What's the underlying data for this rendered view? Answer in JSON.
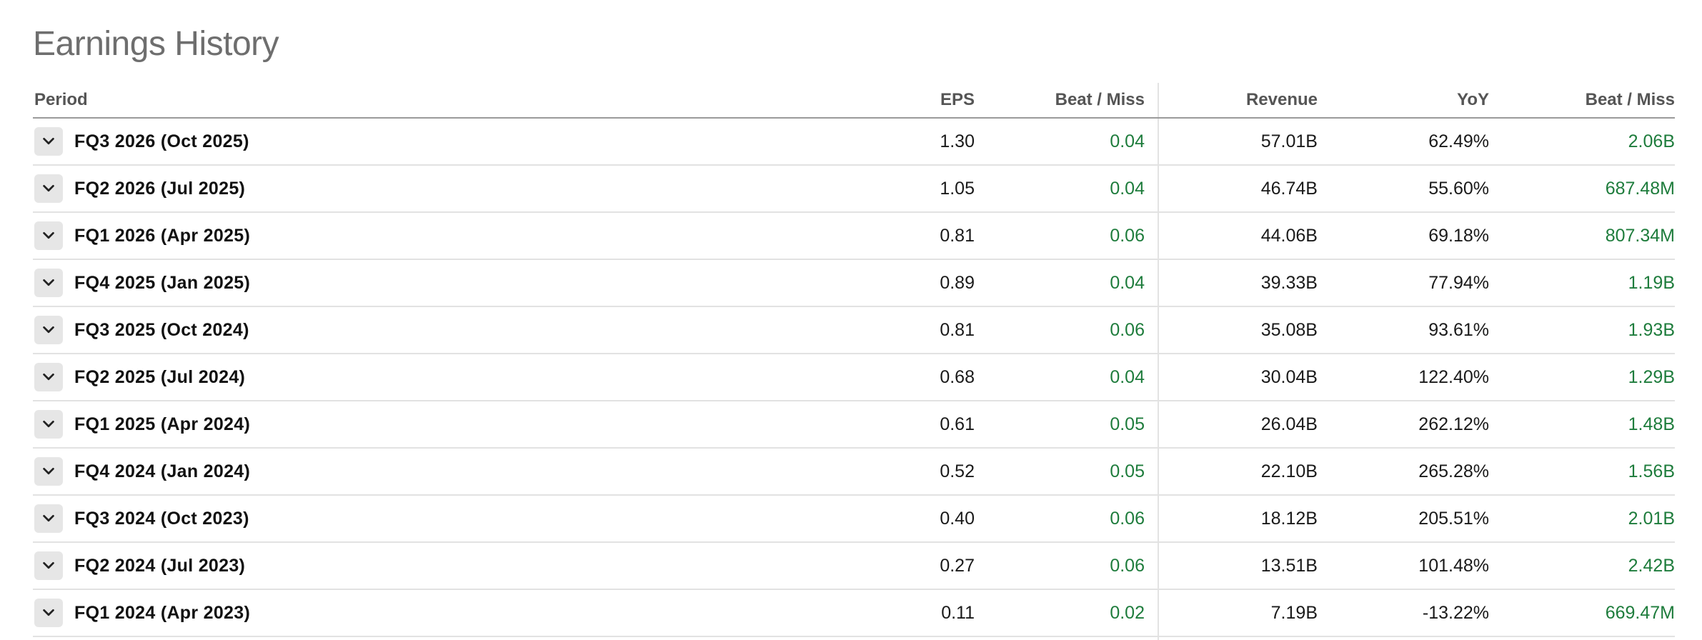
{
  "title": "Earnings History",
  "columns": {
    "period": "Period",
    "eps": "EPS",
    "eps_beat_miss": "Beat / Miss",
    "revenue": "Revenue",
    "yoy": "YoY",
    "revenue_beat_miss": "Beat / Miss"
  },
  "icons": {
    "expander": "chevron-down-icon"
  },
  "colors": {
    "positive": "#1e7c3c"
  },
  "rows": [
    {
      "period": "FQ3 2026 (Oct 2025)",
      "eps": "1.30",
      "eps_beat_miss": "0.04",
      "revenue": "57.01B",
      "yoy": "62.49%",
      "revenue_beat_miss": "2.06B"
    },
    {
      "period": "FQ2 2026 (Jul 2025)",
      "eps": "1.05",
      "eps_beat_miss": "0.04",
      "revenue": "46.74B",
      "yoy": "55.60%",
      "revenue_beat_miss": "687.48M"
    },
    {
      "period": "FQ1 2026 (Apr 2025)",
      "eps": "0.81",
      "eps_beat_miss": "0.06",
      "revenue": "44.06B",
      "yoy": "69.18%",
      "revenue_beat_miss": "807.34M"
    },
    {
      "period": "FQ4 2025 (Jan 2025)",
      "eps": "0.89",
      "eps_beat_miss": "0.04",
      "revenue": "39.33B",
      "yoy": "77.94%",
      "revenue_beat_miss": "1.19B"
    },
    {
      "period": "FQ3 2025 (Oct 2024)",
      "eps": "0.81",
      "eps_beat_miss": "0.06",
      "revenue": "35.08B",
      "yoy": "93.61%",
      "revenue_beat_miss": "1.93B"
    },
    {
      "period": "FQ2 2025 (Jul 2024)",
      "eps": "0.68",
      "eps_beat_miss": "0.04",
      "revenue": "30.04B",
      "yoy": "122.40%",
      "revenue_beat_miss": "1.29B"
    },
    {
      "period": "FQ1 2025 (Apr 2024)",
      "eps": "0.61",
      "eps_beat_miss": "0.05",
      "revenue": "26.04B",
      "yoy": "262.12%",
      "revenue_beat_miss": "1.48B"
    },
    {
      "period": "FQ4 2024 (Jan 2024)",
      "eps": "0.52",
      "eps_beat_miss": "0.05",
      "revenue": "22.10B",
      "yoy": "265.28%",
      "revenue_beat_miss": "1.56B"
    },
    {
      "period": "FQ3 2024 (Oct 2023)",
      "eps": "0.40",
      "eps_beat_miss": "0.06",
      "revenue": "18.12B",
      "yoy": "205.51%",
      "revenue_beat_miss": "2.01B"
    },
    {
      "period": "FQ2 2024 (Jul 2023)",
      "eps": "0.27",
      "eps_beat_miss": "0.06",
      "revenue": "13.51B",
      "yoy": "101.48%",
      "revenue_beat_miss": "2.42B"
    },
    {
      "period": "FQ1 2024 (Apr 2023)",
      "eps": "0.11",
      "eps_beat_miss": "0.02",
      "revenue": "7.19B",
      "yoy": "-13.22%",
      "revenue_beat_miss": "669.47M"
    }
  ]
}
